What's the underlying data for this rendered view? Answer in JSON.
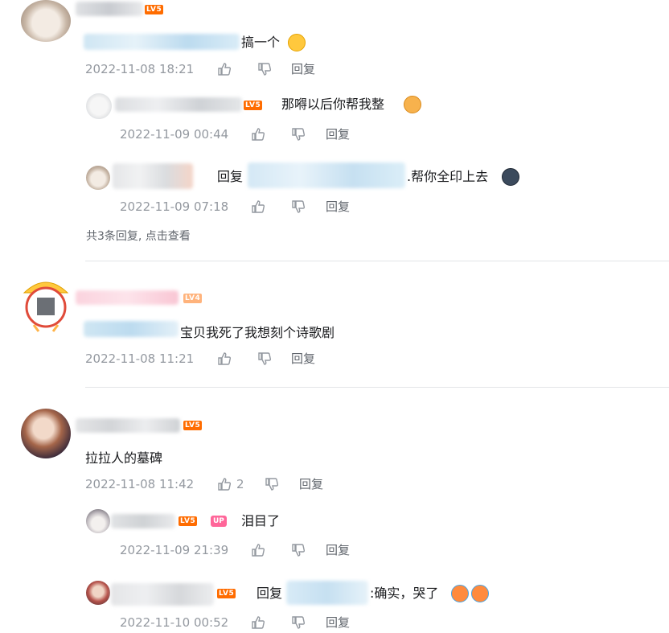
{
  "comments": [
    {
      "level": "LV5",
      "content": "搞一个",
      "time": "2022-11-08 18:21",
      "reply_label": "回复",
      "replies": [
        {
          "level": "LV5",
          "content": "那嘚以后你帮我整",
          "time": "2022-11-09 00:44",
          "reply_label": "回复"
        },
        {
          "prefix": "回复",
          "content": ".帮你全印上去",
          "time": "2022-11-09 07:18",
          "reply_label": "回复"
        }
      ],
      "more_replies": "共3条回复, 点击查看"
    },
    {
      "level": "LV4",
      "content": "宝贝我死了我想刻个诗歌剧",
      "time": "2022-11-08 11:21",
      "reply_label": "回复"
    },
    {
      "level": "LV5",
      "content": "拉拉人的墓碑",
      "time": "2022-11-08 11:42",
      "likes": "2",
      "reply_label": "回复",
      "replies": [
        {
          "level": "LV5",
          "badge": "UP",
          "content": "泪目了",
          "time": "2022-11-09 21:39",
          "reply_label": "回复"
        },
        {
          "level": "LV5",
          "prefix": "回复",
          "content": ":确实，哭了",
          "time": "2022-11-10 00:52",
          "reply_label": "回复"
        }
      ]
    }
  ],
  "colors": {
    "accent_level5": "#ff6c00",
    "accent_level4": "#ffb37c",
    "up_badge": "#ff6699",
    "meta": "#9499a0"
  }
}
